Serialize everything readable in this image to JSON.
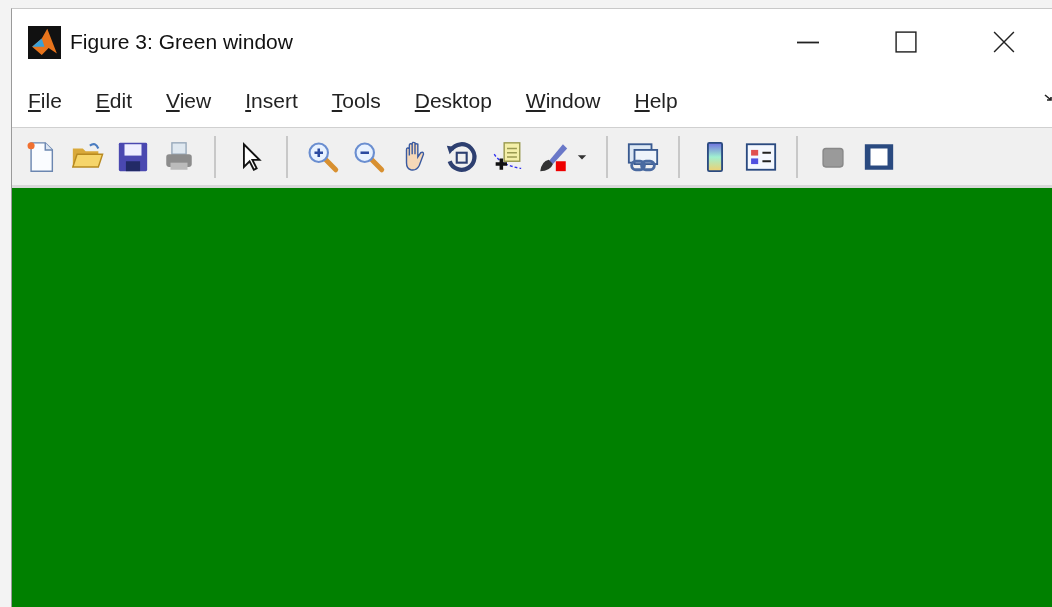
{
  "window": {
    "title": "Figure 3: Green window"
  },
  "menu": [
    {
      "label": "File"
    },
    {
      "label": "Edit"
    },
    {
      "label": "View"
    },
    {
      "label": "Insert"
    },
    {
      "label": "Tools"
    },
    {
      "label": "Desktop"
    },
    {
      "label": "Window"
    },
    {
      "label": "Help"
    }
  ],
  "toolbar": [
    {
      "kind": "new"
    },
    {
      "kind": "open"
    },
    {
      "kind": "save"
    },
    {
      "kind": "print"
    },
    {
      "kind": "separator"
    },
    {
      "kind": "pointer"
    },
    {
      "kind": "separator"
    },
    {
      "kind": "zoom-in"
    },
    {
      "kind": "zoom-out"
    },
    {
      "kind": "pan"
    },
    {
      "kind": "rotate"
    },
    {
      "kind": "data-cursor"
    },
    {
      "kind": "brush"
    },
    {
      "kind": "caret"
    },
    {
      "kind": "separator"
    },
    {
      "kind": "link"
    },
    {
      "kind": "separator"
    },
    {
      "kind": "colorbar"
    },
    {
      "kind": "legend"
    },
    {
      "kind": "separator"
    },
    {
      "kind": "hide-tools"
    },
    {
      "kind": "show-tools"
    }
  ]
}
